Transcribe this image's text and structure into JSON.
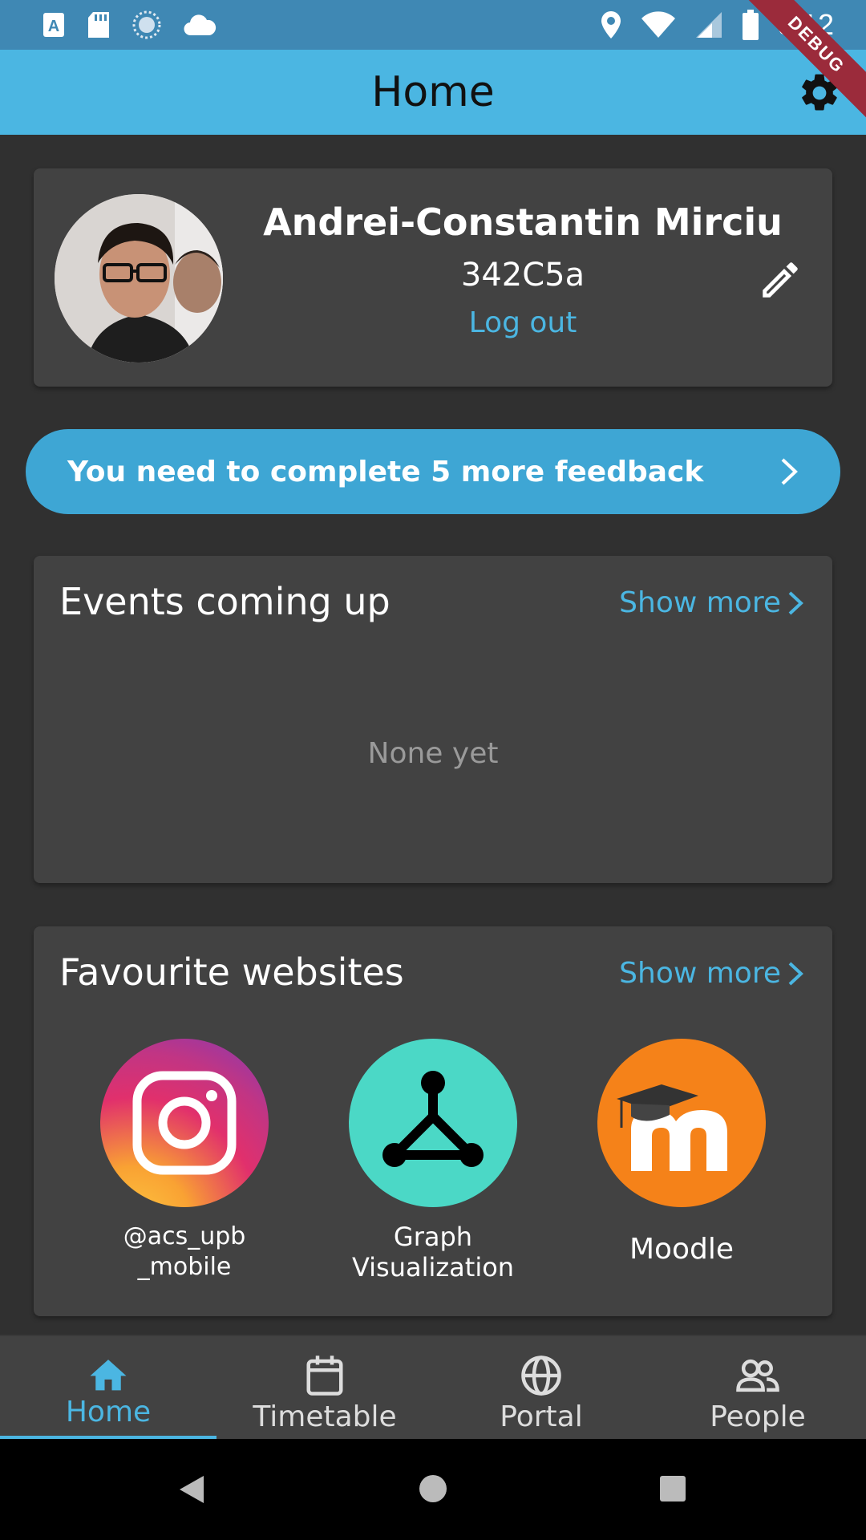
{
  "status_bar": {
    "time": "9:12",
    "debug_label": "DEBUG"
  },
  "app_bar": {
    "title": "Home"
  },
  "profile": {
    "name": "Andrei-Constantin Mirciu",
    "group": "342C5a",
    "logout_label": "Log out"
  },
  "feedback_banner": {
    "text": "You need to complete 5 more feedback"
  },
  "events": {
    "title": "Events coming up",
    "show_more_label": "Show more",
    "empty_text": "None yet"
  },
  "favourites": {
    "title": "Favourite websites",
    "show_more_label": "Show more",
    "sites": [
      {
        "label": "@acs_upb\n_mobile",
        "line1": "@acs_upb",
        "line2": "_mobile",
        "icon": "instagram-icon"
      },
      {
        "label": "Graph Visualization",
        "line1": "Graph",
        "line2": "Visualization",
        "icon": "graph-icon"
      },
      {
        "label": "Moodle",
        "line1": "Moodle",
        "line2": "",
        "icon": "moodle-icon"
      }
    ]
  },
  "bottom_nav": {
    "items": [
      {
        "label": "Home",
        "icon": "home-icon",
        "active": true
      },
      {
        "label": "Timetable",
        "icon": "calendar-icon",
        "active": false
      },
      {
        "label": "Portal",
        "icon": "globe-icon",
        "active": false
      },
      {
        "label": "People",
        "icon": "people-icon",
        "active": false
      }
    ]
  },
  "colors": {
    "accent": "#4bb6e2",
    "background": "#303030",
    "card": "#424242"
  }
}
